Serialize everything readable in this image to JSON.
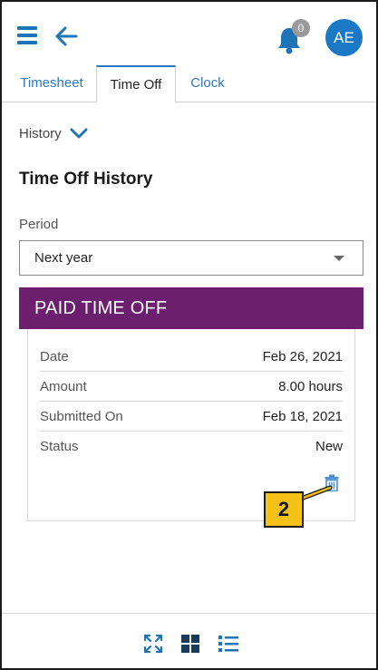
{
  "header": {
    "menu_icon": "hamburger-menu-icon",
    "back_icon": "arrow-left-icon",
    "notifications": {
      "icon": "bell-icon",
      "count": "0"
    },
    "avatar_initials": "AE"
  },
  "tabs": [
    {
      "label": "Timesheet",
      "active": false
    },
    {
      "label": "Time Off",
      "active": true
    },
    {
      "label": "Clock",
      "active": false
    }
  ],
  "history_toggle": {
    "label": "History",
    "icon": "chevron-down-icon"
  },
  "page_title": "Time Off History",
  "period": {
    "label": "Period",
    "selected": "Next year"
  },
  "entry": {
    "type_label": "PAID TIME OFF",
    "rows": [
      {
        "key": "Date",
        "value": "Feb 26, 2021"
      },
      {
        "key": "Amount",
        "value": "8.00 hours"
      },
      {
        "key": "Submitted On",
        "value": "Feb 18, 2021"
      },
      {
        "key": "Status",
        "value": "New"
      }
    ],
    "delete_icon": "trash-icon"
  },
  "callout": {
    "label": "2"
  },
  "footer": {
    "icons": [
      "expand-icon",
      "grid-view-icon",
      "list-view-icon"
    ]
  },
  "colors": {
    "accent": "#1f73b7",
    "banner": "#6b1f6e",
    "callout": "#f6c218"
  }
}
